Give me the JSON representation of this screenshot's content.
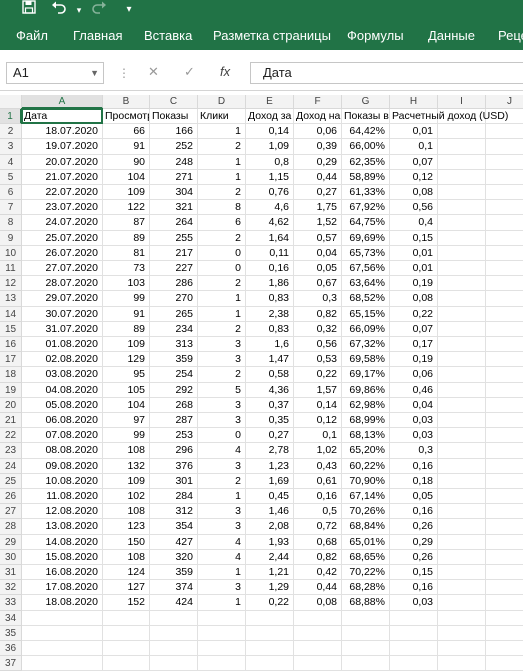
{
  "quick_access": {
    "save_icon": "save-icon",
    "undo_icon": "undo-icon",
    "redo_icon": "redo-icon",
    "customize_icon": "customize-icon"
  },
  "ribbon_tabs": [
    "Файл",
    "Главная",
    "Вставка",
    "Разметка страницы",
    "Формулы",
    "Данные",
    "Реце"
  ],
  "formula_bar": {
    "name_box": "A1",
    "content": "Дата",
    "cancel_glyph": "✕",
    "enter_glyph": "✓",
    "fx_glyph": "fx"
  },
  "columns": [
    "A",
    "B",
    "C",
    "D",
    "E",
    "F",
    "G",
    "H",
    "I",
    "J"
  ],
  "headers": [
    "Дата",
    "Просмотры",
    "Показы",
    "Клики",
    "Доход за",
    "Доход на",
    "Показы в",
    "Расчетный доход (USD)"
  ],
  "rows": [
    [
      "18.07.2020",
      "66",
      "166",
      "1",
      "0,14",
      "0,06",
      "64,42%",
      "0,01"
    ],
    [
      "19.07.2020",
      "91",
      "252",
      "2",
      "1,09",
      "0,39",
      "66,00%",
      "0,1"
    ],
    [
      "20.07.2020",
      "90",
      "248",
      "1",
      "0,8",
      "0,29",
      "62,35%",
      "0,07"
    ],
    [
      "21.07.2020",
      "104",
      "271",
      "1",
      "1,15",
      "0,44",
      "58,89%",
      "0,12"
    ],
    [
      "22.07.2020",
      "109",
      "304",
      "2",
      "0,76",
      "0,27",
      "61,33%",
      "0,08"
    ],
    [
      "23.07.2020",
      "122",
      "321",
      "8",
      "4,6",
      "1,75",
      "67,92%",
      "0,56"
    ],
    [
      "24.07.2020",
      "87",
      "264",
      "6",
      "4,62",
      "1,52",
      "64,75%",
      "0,4"
    ],
    [
      "25.07.2020",
      "89",
      "255",
      "2",
      "1,64",
      "0,57",
      "69,69%",
      "0,15"
    ],
    [
      "26.07.2020",
      "81",
      "217",
      "0",
      "0,11",
      "0,04",
      "65,73%",
      "0,01"
    ],
    [
      "27.07.2020",
      "73",
      "227",
      "0",
      "0,16",
      "0,05",
      "67,56%",
      "0,01"
    ],
    [
      "28.07.2020",
      "103",
      "286",
      "2",
      "1,86",
      "0,67",
      "63,64%",
      "0,19"
    ],
    [
      "29.07.2020",
      "99",
      "270",
      "1",
      "0,83",
      "0,3",
      "68,52%",
      "0,08"
    ],
    [
      "30.07.2020",
      "91",
      "265",
      "1",
      "2,38",
      "0,82",
      "65,15%",
      "0,22"
    ],
    [
      "31.07.2020",
      "89",
      "234",
      "2",
      "0,83",
      "0,32",
      "66,09%",
      "0,07"
    ],
    [
      "01.08.2020",
      "109",
      "313",
      "3",
      "1,6",
      "0,56",
      "67,32%",
      "0,17"
    ],
    [
      "02.08.2020",
      "129",
      "359",
      "3",
      "1,47",
      "0,53",
      "69,58%",
      "0,19"
    ],
    [
      "03.08.2020",
      "95",
      "254",
      "2",
      "0,58",
      "0,22",
      "69,17%",
      "0,06"
    ],
    [
      "04.08.2020",
      "105",
      "292",
      "5",
      "4,36",
      "1,57",
      "69,86%",
      "0,46"
    ],
    [
      "05.08.2020",
      "104",
      "268",
      "3",
      "0,37",
      "0,14",
      "62,98%",
      "0,04"
    ],
    [
      "06.08.2020",
      "97",
      "287",
      "3",
      "0,35",
      "0,12",
      "68,99%",
      "0,03"
    ],
    [
      "07.08.2020",
      "99",
      "253",
      "0",
      "0,27",
      "0,1",
      "68,13%",
      "0,03"
    ],
    [
      "08.08.2020",
      "108",
      "296",
      "4",
      "2,78",
      "1,02",
      "65,20%",
      "0,3"
    ],
    [
      "09.08.2020",
      "132",
      "376",
      "3",
      "1,23",
      "0,43",
      "60,22%",
      "0,16"
    ],
    [
      "10.08.2020",
      "109",
      "301",
      "2",
      "1,69",
      "0,61",
      "70,90%",
      "0,18"
    ],
    [
      "11.08.2020",
      "102",
      "284",
      "1",
      "0,45",
      "0,16",
      "67,14%",
      "0,05"
    ],
    [
      "12.08.2020",
      "108",
      "312",
      "3",
      "1,46",
      "0,5",
      "70,26%",
      "0,16"
    ],
    [
      "13.08.2020",
      "123",
      "354",
      "3",
      "2,08",
      "0,72",
      "68,84%",
      "0,26"
    ],
    [
      "14.08.2020",
      "150",
      "427",
      "4",
      "1,93",
      "0,68",
      "65,01%",
      "0,29"
    ],
    [
      "15.08.2020",
      "108",
      "320",
      "4",
      "2,44",
      "0,82",
      "68,65%",
      "0,26"
    ],
    [
      "16.08.2020",
      "124",
      "359",
      "1",
      "1,21",
      "0,42",
      "70,22%",
      "0,15"
    ],
    [
      "17.08.2020",
      "127",
      "374",
      "3",
      "1,29",
      "0,44",
      "68,28%",
      "0,16"
    ],
    [
      "18.08.2020",
      "152",
      "424",
      "1",
      "0,22",
      "0,08",
      "68,88%",
      "0,03"
    ]
  ],
  "row_numbers": [
    "1",
    "2",
    "3",
    "4",
    "5",
    "6",
    "7",
    "8",
    "9",
    "10",
    "11",
    "12",
    "13",
    "14",
    "15",
    "16",
    "17",
    "18",
    "19",
    "20",
    "21",
    "22",
    "23",
    "24",
    "25",
    "26",
    "27",
    "28",
    "29",
    "30",
    "31",
    "32",
    "33",
    "34",
    "35",
    "36",
    "37"
  ],
  "colors": {
    "accent": "#217346",
    "header_bg": "#f3f3f3",
    "gridline": "#e1e1e1"
  }
}
